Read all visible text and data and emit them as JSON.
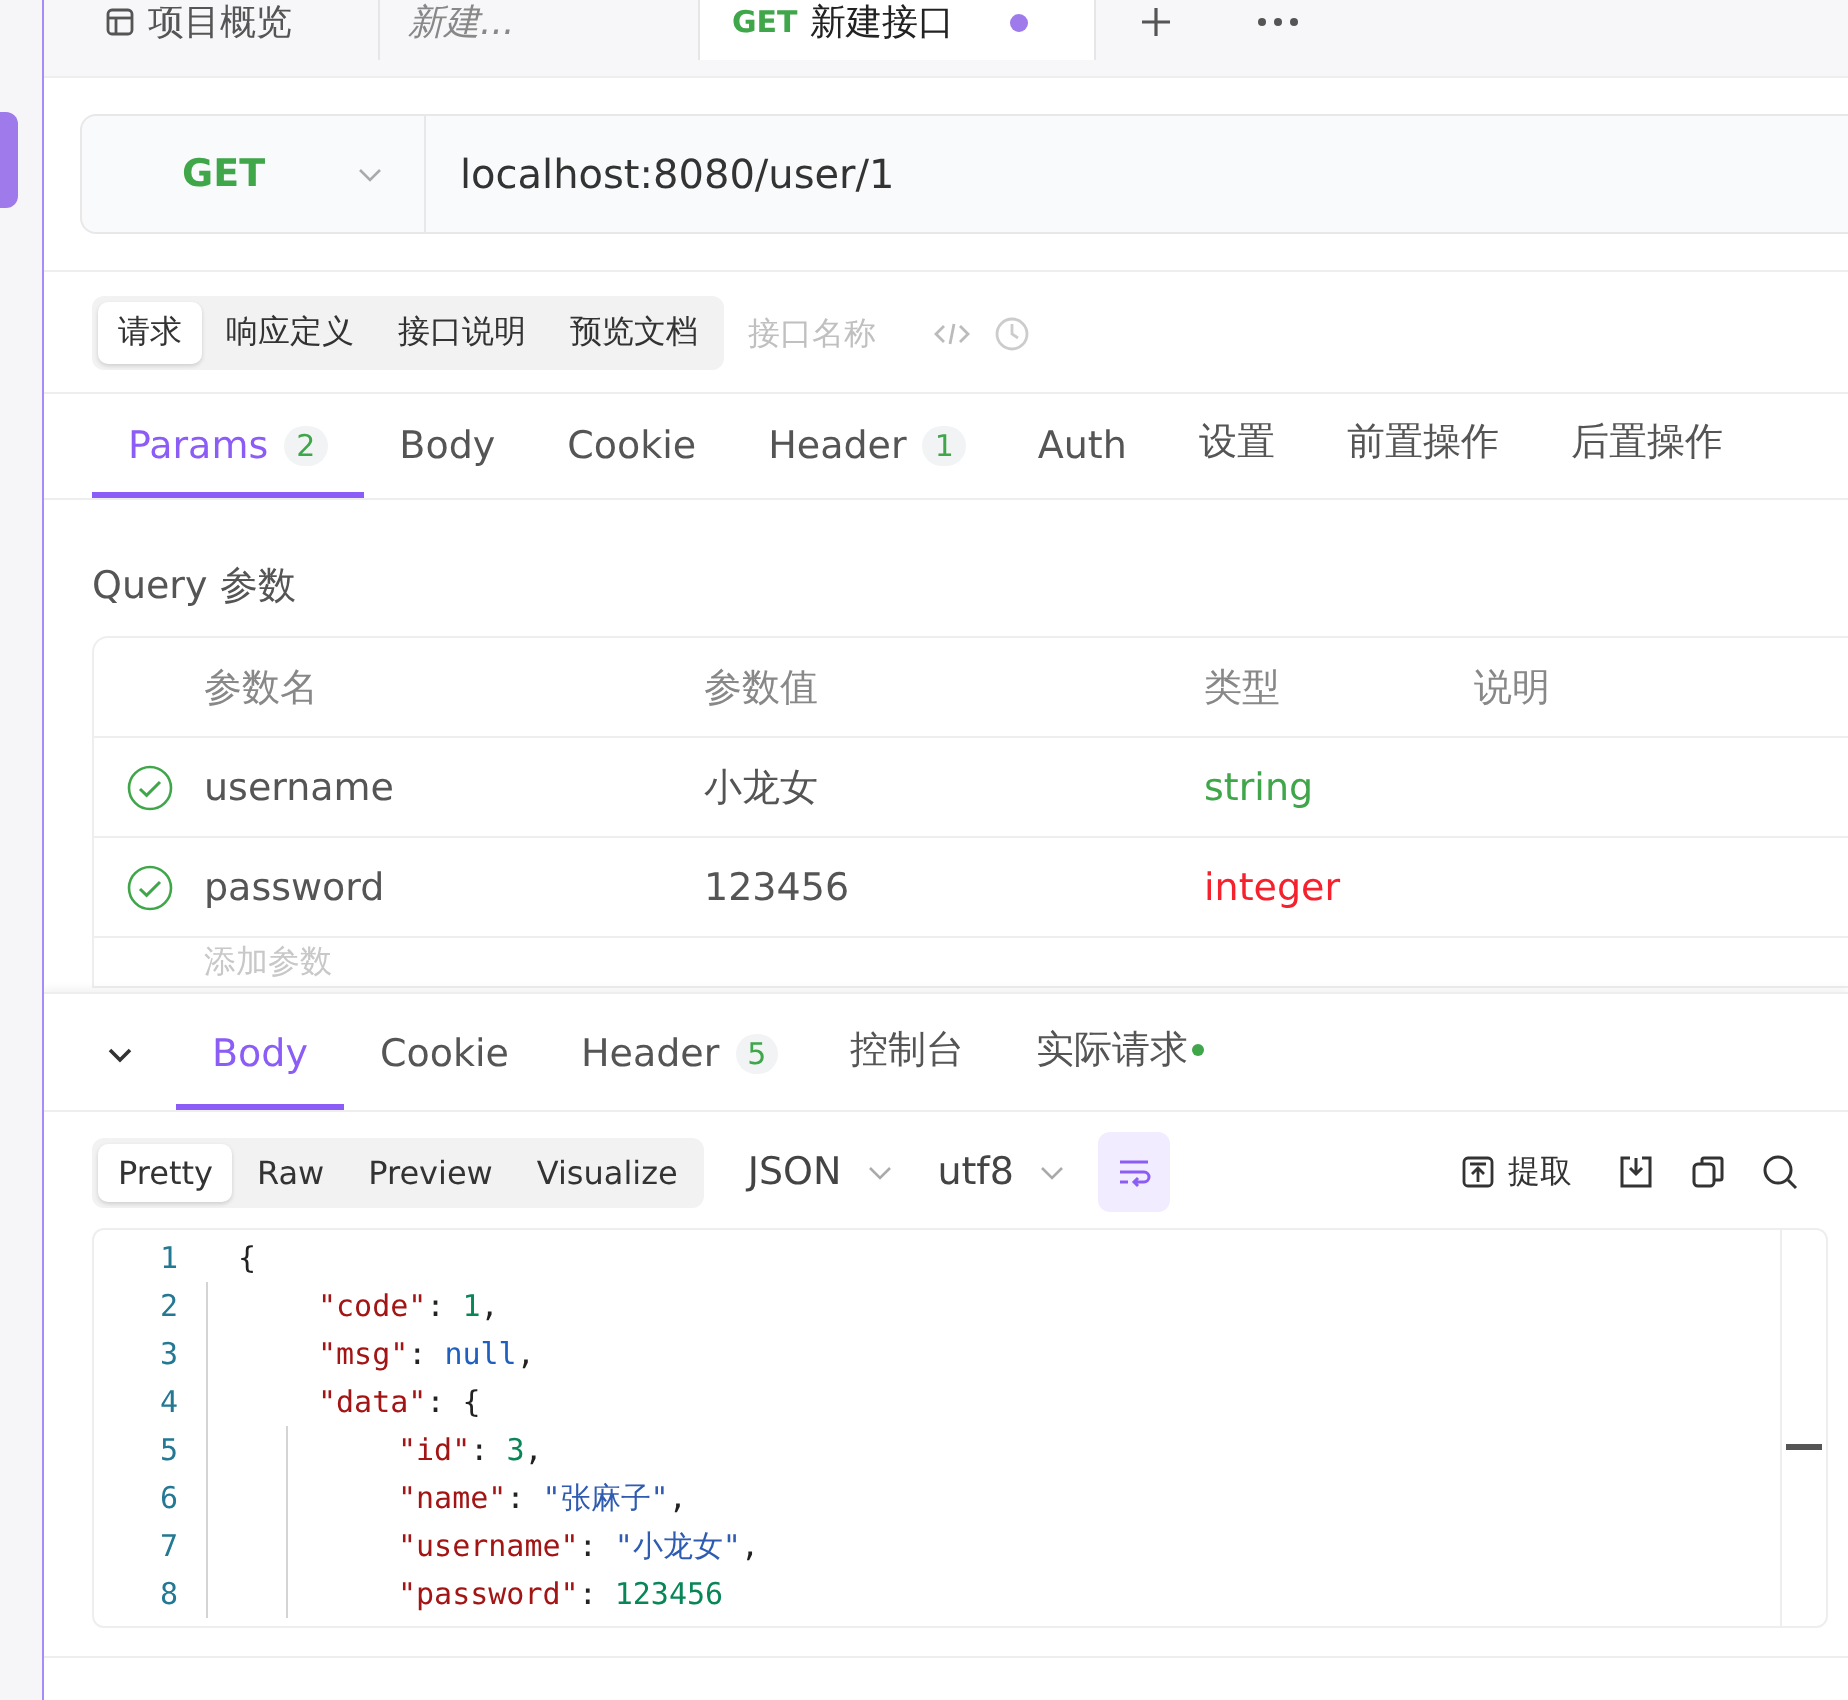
{
  "top_tabs": [
    {
      "kind": "overview",
      "label": "项目概览",
      "selected": false
    },
    {
      "kind": "draft",
      "label": "新建...",
      "selected": false
    },
    {
      "kind": "request",
      "method": "GET",
      "label": "新建接口",
      "selected": true,
      "unsaved": true
    }
  ],
  "request": {
    "method": "GET",
    "url": "localhost:8080/user/1"
  },
  "doc_tabs": [
    {
      "label": "请求",
      "selected": true
    },
    {
      "label": "响应定义",
      "selected": false
    },
    {
      "label": "接口说明",
      "selected": false
    },
    {
      "label": "预览文档",
      "selected": false
    }
  ],
  "name_placeholder": "接口名称",
  "param_tabs": [
    {
      "label": "Params",
      "count": "2",
      "selected": true
    },
    {
      "label": "Body",
      "selected": false
    },
    {
      "label": "Cookie",
      "selected": false
    },
    {
      "label": "Header",
      "count": "1",
      "selected": false
    },
    {
      "label": "Auth",
      "selected": false
    },
    {
      "label": "设置",
      "selected": false
    },
    {
      "label": "前置操作",
      "selected": false
    },
    {
      "label": "后置操作",
      "selected": false
    }
  ],
  "query_title": "Query 参数",
  "table": {
    "columns": [
      "参数名",
      "参数值",
      "类型",
      "说明"
    ],
    "rows": [
      {
        "checked": true,
        "name": "username",
        "value": "小龙女",
        "type": "string",
        "color": "#3fa64a"
      },
      {
        "checked": true,
        "name": "password",
        "value": "123456",
        "type": "integer",
        "color": "#f5222d"
      }
    ],
    "add_placeholder": "添加参数"
  },
  "response_tabs": [
    {
      "label": "Body",
      "selected": true
    },
    {
      "label": "Cookie",
      "selected": false
    },
    {
      "label": "Header",
      "count": "5",
      "selected": false
    },
    {
      "label": "控制台",
      "selected": false
    },
    {
      "label": "实际请求",
      "dot": true,
      "selected": false
    }
  ],
  "view_modes": [
    {
      "label": "Pretty",
      "selected": true
    },
    {
      "label": "Raw",
      "selected": false
    },
    {
      "label": "Preview",
      "selected": false
    },
    {
      "label": "Visualize",
      "selected": false
    }
  ],
  "format": "JSON",
  "encoding": "utf8",
  "wrap_on": true,
  "extract_label": "提取",
  "code": [
    {
      "n": "1",
      "tokens": [
        {
          "text": "{",
          "kind": "punct"
        }
      ],
      "children": [
        {
          "n": "2",
          "tokens": [
            {
              "text": "\"code\"",
              "kind": "key"
            },
            {
              "text": ": ",
              "kind": "punct"
            },
            {
              "text": "1",
              "kind": "num"
            },
            {
              "text": ",",
              "kind": "punct"
            }
          ]
        },
        {
          "n": "3",
          "tokens": [
            {
              "text": "\"msg\"",
              "kind": "key"
            },
            {
              "text": ": ",
              "kind": "punct"
            },
            {
              "text": "null",
              "kind": "null"
            },
            {
              "text": ",",
              "kind": "punct"
            }
          ]
        },
        {
          "n": "4",
          "tokens": [
            {
              "text": "\"data\"",
              "kind": "key"
            },
            {
              "text": ": {",
              "kind": "punct"
            }
          ],
          "children": [
            {
              "n": "5",
              "tokens": [
                {
                  "text": "\"id\"",
                  "kind": "key"
                },
                {
                  "text": ": ",
                  "kind": "punct"
                },
                {
                  "text": "3",
                  "kind": "num"
                },
                {
                  "text": ",",
                  "kind": "punct"
                }
              ]
            },
            {
              "n": "6",
              "tokens": [
                {
                  "text": "\"name\"",
                  "kind": "key"
                },
                {
                  "text": ": ",
                  "kind": "punct"
                },
                {
                  "text": "\"张麻子\"",
                  "kind": "str"
                },
                {
                  "text": ",",
                  "kind": "punct"
                }
              ]
            },
            {
              "n": "7",
              "tokens": [
                {
                  "text": "\"username\"",
                  "kind": "key"
                },
                {
                  "text": ": ",
                  "kind": "punct"
                },
                {
                  "text": "\"小龙女\"",
                  "kind": "str"
                },
                {
                  "text": ",",
                  "kind": "punct"
                }
              ]
            },
            {
              "n": "8",
              "tokens": [
                {
                  "text": "\"password\"",
                  "kind": "key"
                },
                {
                  "text": ": ",
                  "kind": "punct"
                },
                {
                  "text": "123456",
                  "kind": "num"
                }
              ]
            }
          ]
        }
      ]
    }
  ]
}
